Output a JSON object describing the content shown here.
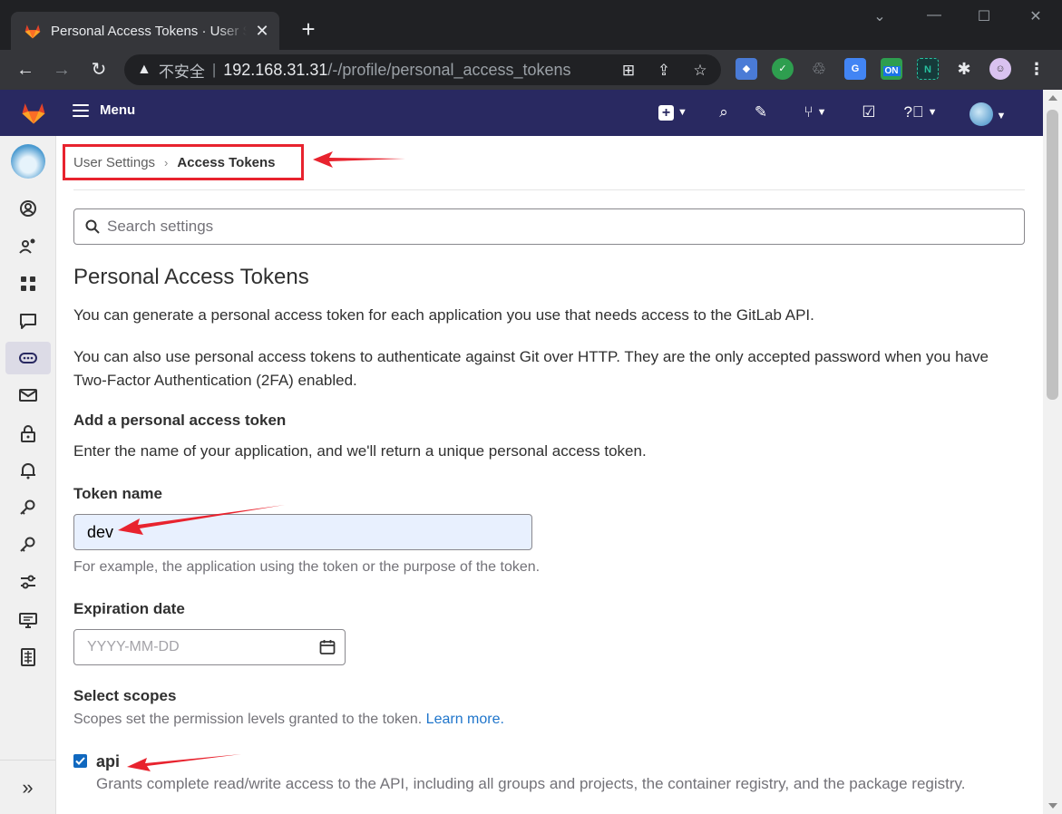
{
  "browser": {
    "tab_title": "Personal Access Tokens · User Settings · GitLab",
    "tab_close": "✕",
    "new_tab": "+",
    "insecure_label": "不安全",
    "url_host": "192.168.31.31",
    "url_path": "/-/profile/personal_access_tokens",
    "ext_on_label": "ON"
  },
  "header": {
    "menu_label": "Menu",
    "icons": [
      "plus-icon",
      "search-icon",
      "merge-request-icon",
      "todo-icon",
      "help-icon",
      "avatar"
    ]
  },
  "sidebar": {
    "items": [
      "profile",
      "account",
      "applications",
      "chat",
      "access-tokens",
      "emails",
      "password",
      "notifications",
      "ssh-keys",
      "gpg-keys",
      "preferences",
      "active-sessions",
      "authentication-log"
    ],
    "active": "access-tokens"
  },
  "breadcrumb": {
    "parent": "User Settings",
    "current": "Access Tokens"
  },
  "search": {
    "placeholder": "Search settings"
  },
  "page": {
    "title": "Personal Access Tokens",
    "intro1": "You can generate a personal access token for each application you use that needs access to the GitLab API.",
    "intro2": "You can also use personal access tokens to authenticate against Git over HTTP. They are the only accepted password when you have Two-Factor Authentication (2FA) enabled."
  },
  "form": {
    "section_title": "Add a personal access token",
    "section_desc": "Enter the name of your application, and we'll return a unique personal access token.",
    "token_name_label": "Token name",
    "token_name_value": "dev",
    "token_name_help": "For example, the application using the token or the purpose of the token.",
    "expiration_label": "Expiration date",
    "expiration_placeholder": "YYYY-MM-DD",
    "scopes_label": "Select scopes",
    "scopes_help": "Scopes set the permission levels granted to the token.",
    "learn_more": "Learn more.",
    "scopes": [
      {
        "name": "api",
        "checked": true,
        "description": "Grants complete read/write access to the API, including all groups and projects, the container registry, and the package registry."
      }
    ]
  },
  "colors": {
    "header_bg": "#292961",
    "annotation_red": "#e8232e",
    "link": "#1f75cb",
    "checkbox": "#1068bf"
  }
}
